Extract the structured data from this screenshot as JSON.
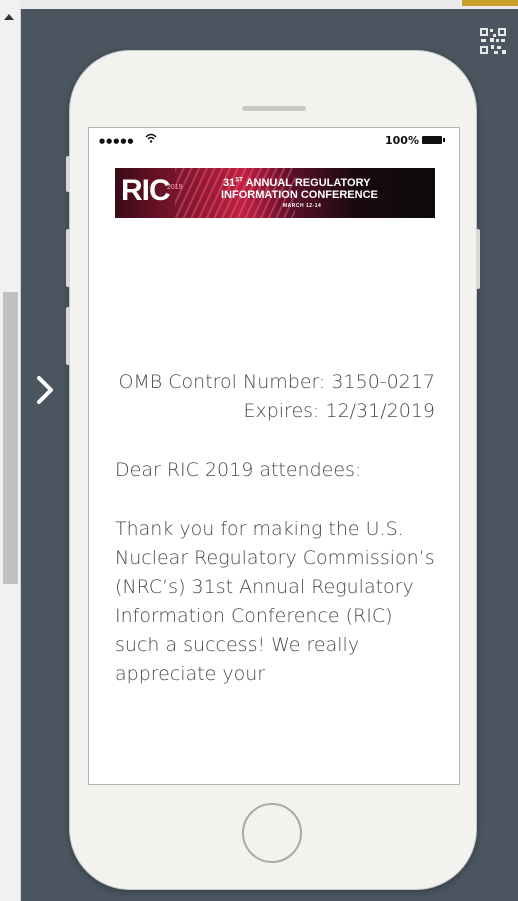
{
  "left_panel": {
    "scroll_up_icon": "triangle-up",
    "next_icon": "chevron-right"
  },
  "qr_icon": "qr-code-icon",
  "status_bar": {
    "signal": "●●●●●",
    "battery": "100%"
  },
  "banner": {
    "logo": "RIC",
    "logo_year": "2019",
    "line1_prefix": "31",
    "line1_suffix": "ST",
    "line1_rest": " ANNUAL REGULATORY",
    "line2": "INFORMATION CONFERENCE",
    "dates": "MARCH 12-14"
  },
  "letter": {
    "omb": "OMB Control Number: 3150-0217",
    "expires": "Expires: 12/31/2019",
    "greeting": "Dear RIC 2019 attendees:",
    "body": "Thank you for making the U.S. Nuclear Regulatory Commission’s (NRC’s) 31st Annual Regulatory Information Conference (RIC) such a success!  We really appreciate your"
  },
  "colors": {
    "page_bg": "#4a5560",
    "phone_body": "#f2f2ef",
    "text": "#4a4a4a"
  }
}
